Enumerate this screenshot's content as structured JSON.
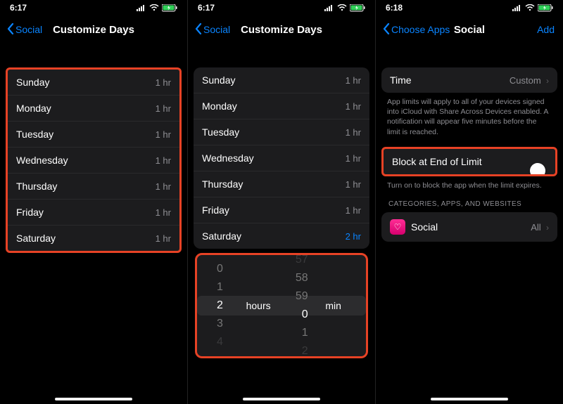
{
  "panel1": {
    "time": "6:17",
    "back": "Social",
    "title": "Customize Days",
    "days": [
      {
        "name": "Sunday",
        "val": "1 hr"
      },
      {
        "name": "Monday",
        "val": "1 hr"
      },
      {
        "name": "Tuesday",
        "val": "1 hr"
      },
      {
        "name": "Wednesday",
        "val": "1 hr"
      },
      {
        "name": "Thursday",
        "val": "1 hr"
      },
      {
        "name": "Friday",
        "val": "1 hr"
      },
      {
        "name": "Saturday",
        "val": "1 hr"
      }
    ]
  },
  "panel2": {
    "time": "6:17",
    "back": "Social",
    "title": "Customize Days",
    "days": [
      {
        "name": "Sunday",
        "val": "1 hr"
      },
      {
        "name": "Monday",
        "val": "1 hr"
      },
      {
        "name": "Tuesday",
        "val": "1 hr"
      },
      {
        "name": "Wednesday",
        "val": "1 hr"
      },
      {
        "name": "Thursday",
        "val": "1 hr"
      },
      {
        "name": "Friday",
        "val": "1 hr"
      },
      {
        "name": "Saturday",
        "val": "2 hr",
        "active": true
      }
    ],
    "picker": {
      "hours_label": "hours",
      "mins_label": "min",
      "hours": {
        "far_above": "",
        "above": "0",
        "near": "1",
        "sel": "2",
        "below": "3",
        "far_below": "4"
      },
      "mins": {
        "far_above": "57",
        "above": "58",
        "near": "59",
        "sel": "0",
        "below": "1",
        "far_below": "2"
      }
    }
  },
  "panel3": {
    "time": "6:18",
    "back": "Choose Apps",
    "title": "Social",
    "add": "Add",
    "time_row": {
      "label": "Time",
      "value": "Custom"
    },
    "time_footer": "App limits will apply to all of your devices signed into iCloud with Share Across Devices enabled. A notification will appear five minutes before the limit is reached.",
    "block_row": {
      "label": "Block at End of Limit"
    },
    "block_footer": "Turn on to block the app when the limit expires.",
    "section": "CATEGORIES, APPS, AND WEBSITES",
    "social_row": {
      "label": "Social",
      "value": "All",
      "icon_glyph": "♡"
    }
  }
}
